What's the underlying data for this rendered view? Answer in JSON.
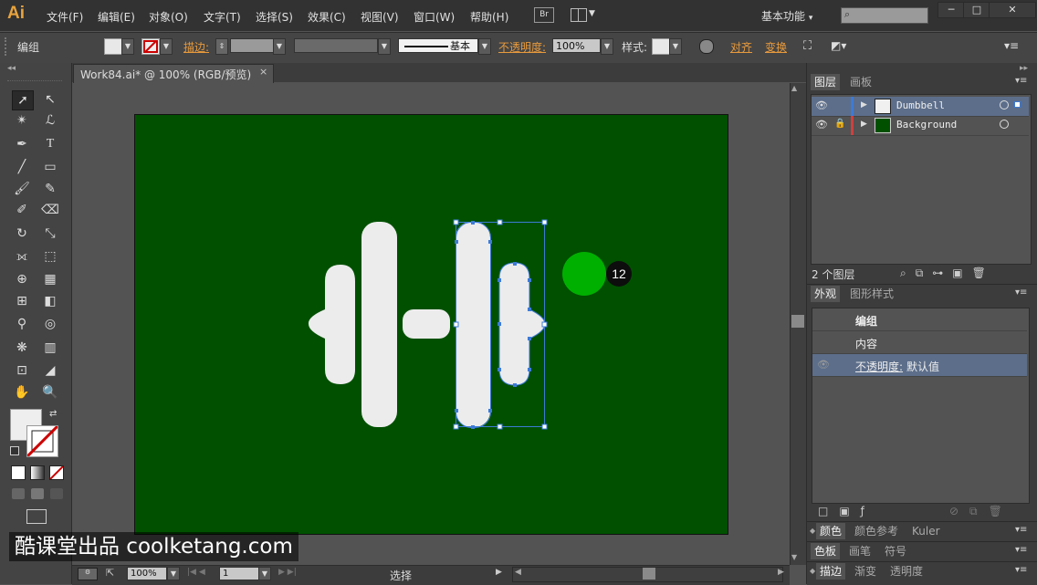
{
  "app": {
    "logo": "Ai"
  },
  "menu": [
    "文件(F)",
    "编辑(E)",
    "对象(O)",
    "文字(T)",
    "选择(S)",
    "效果(C)",
    "视图(V)",
    "窗口(W)",
    "帮助(H)"
  ],
  "bridge_label": "Br",
  "workspace_label": "基本功能",
  "window_controls": {
    "minimize": "─",
    "restore": "□",
    "close": "✕"
  },
  "control_bar": {
    "selection_label": "编组",
    "stroke_label": "描边:",
    "stroke_style_label": "基本",
    "opacity_label": "不透明度:",
    "opacity_value": "100%",
    "style_label": "样式:",
    "align_label": "对齐",
    "transform_label": "变换"
  },
  "document_tab": {
    "title": "Work84.ai* @ 100% (RGB/预览)",
    "close": "×"
  },
  "step_badge": "12",
  "status_bar": {
    "zoom": "100%",
    "page": "1",
    "tool_name": "选择"
  },
  "layers_panel": {
    "tabs": [
      "图层",
      "画板"
    ],
    "layers": [
      {
        "name": "Dumbbell",
        "color": "#3d7bd6",
        "thumb": "#f0f0f0",
        "locked": false,
        "selected": true
      },
      {
        "name": "Background",
        "color": "#d04040",
        "thumb": "#005000",
        "locked": true,
        "selected": false
      }
    ],
    "count_label": "2 个图层"
  },
  "appearance_panel": {
    "tabs": [
      "外观",
      "图形样式"
    ],
    "group_label": "编组",
    "contents_label": "内容",
    "opacity_label": "不透明度:",
    "opacity_value": "默认值"
  },
  "color_panels": {
    "row1": [
      "颜色",
      "颜色参考",
      "Kuler"
    ],
    "row2": [
      "色板",
      "画笔",
      "符号"
    ],
    "row3": [
      "描边",
      "渐变",
      "透明度"
    ]
  },
  "watermark": "酷课堂出品 coolketang.com",
  "colors": {
    "artboard": "#005000",
    "accent": "#e89a3c",
    "selection": "#3d7bd6",
    "shape": "#ececec",
    "marker": "#00b000"
  }
}
